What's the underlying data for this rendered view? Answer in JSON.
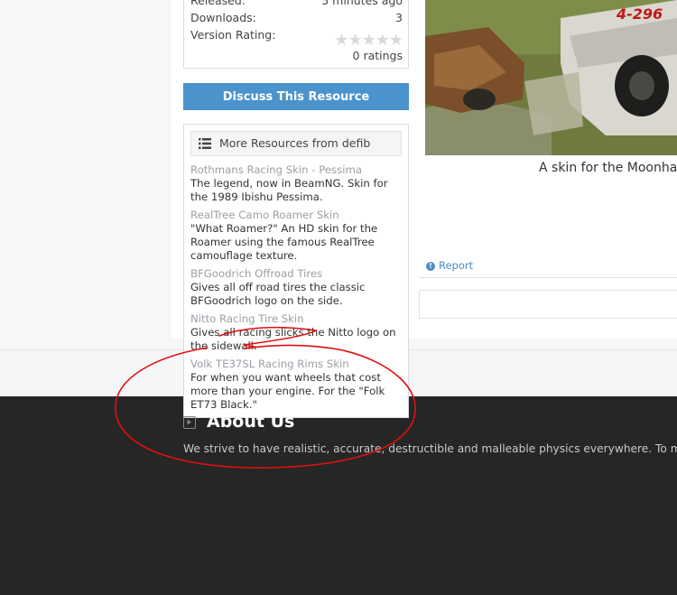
{
  "info": {
    "released_label": "Released:",
    "released_value": "5 minutes ago",
    "downloads_label": "Downloads:",
    "downloads_value": "3",
    "rating_label": "Version Rating:",
    "stars_filled": 0,
    "stars_total": 5,
    "ratings_text": "0 ratings"
  },
  "discuss_button": "Discuss This Resource",
  "more_resources": {
    "title": "More Resources from defib",
    "items": [
      {
        "title": "Rothmans Racing Skin - Pessima",
        "desc": "The legend, now in BeamNG. Skin for the 1989 Ibishu Pessima."
      },
      {
        "title": "RealTree Camo Roamer Skin",
        "desc": "\"What Roamer?\" An HD skin for the Roamer using the famous RealTree camouflage texture."
      },
      {
        "title": "BFGoodrich Offroad Tires",
        "desc": "Gives all off road tires the classic BFGoodrich logo on the side."
      },
      {
        "title": "Nitto Racing Tire Skin",
        "desc": "Gives all racing slicks the Nitto logo on the sidewall."
      },
      {
        "title": "Volk TE37SL Racing Rims Skin",
        "desc": "For when you want wheels that cost more than your engine. For the \"Folk ET73 Black.\""
      }
    ]
  },
  "media": {
    "car_number": "4-296",
    "caption": "A skin for the Moonhaw"
  },
  "report_label": "Report",
  "footer": {
    "about_title": "About Us",
    "about_text": "We strive to have realistic, accurate, destructible and malleable physics everywhere. To ma"
  },
  "colors": {
    "accent": "#4b93cc",
    "footer_bg": "#262626",
    "annotation": "#e01010"
  }
}
